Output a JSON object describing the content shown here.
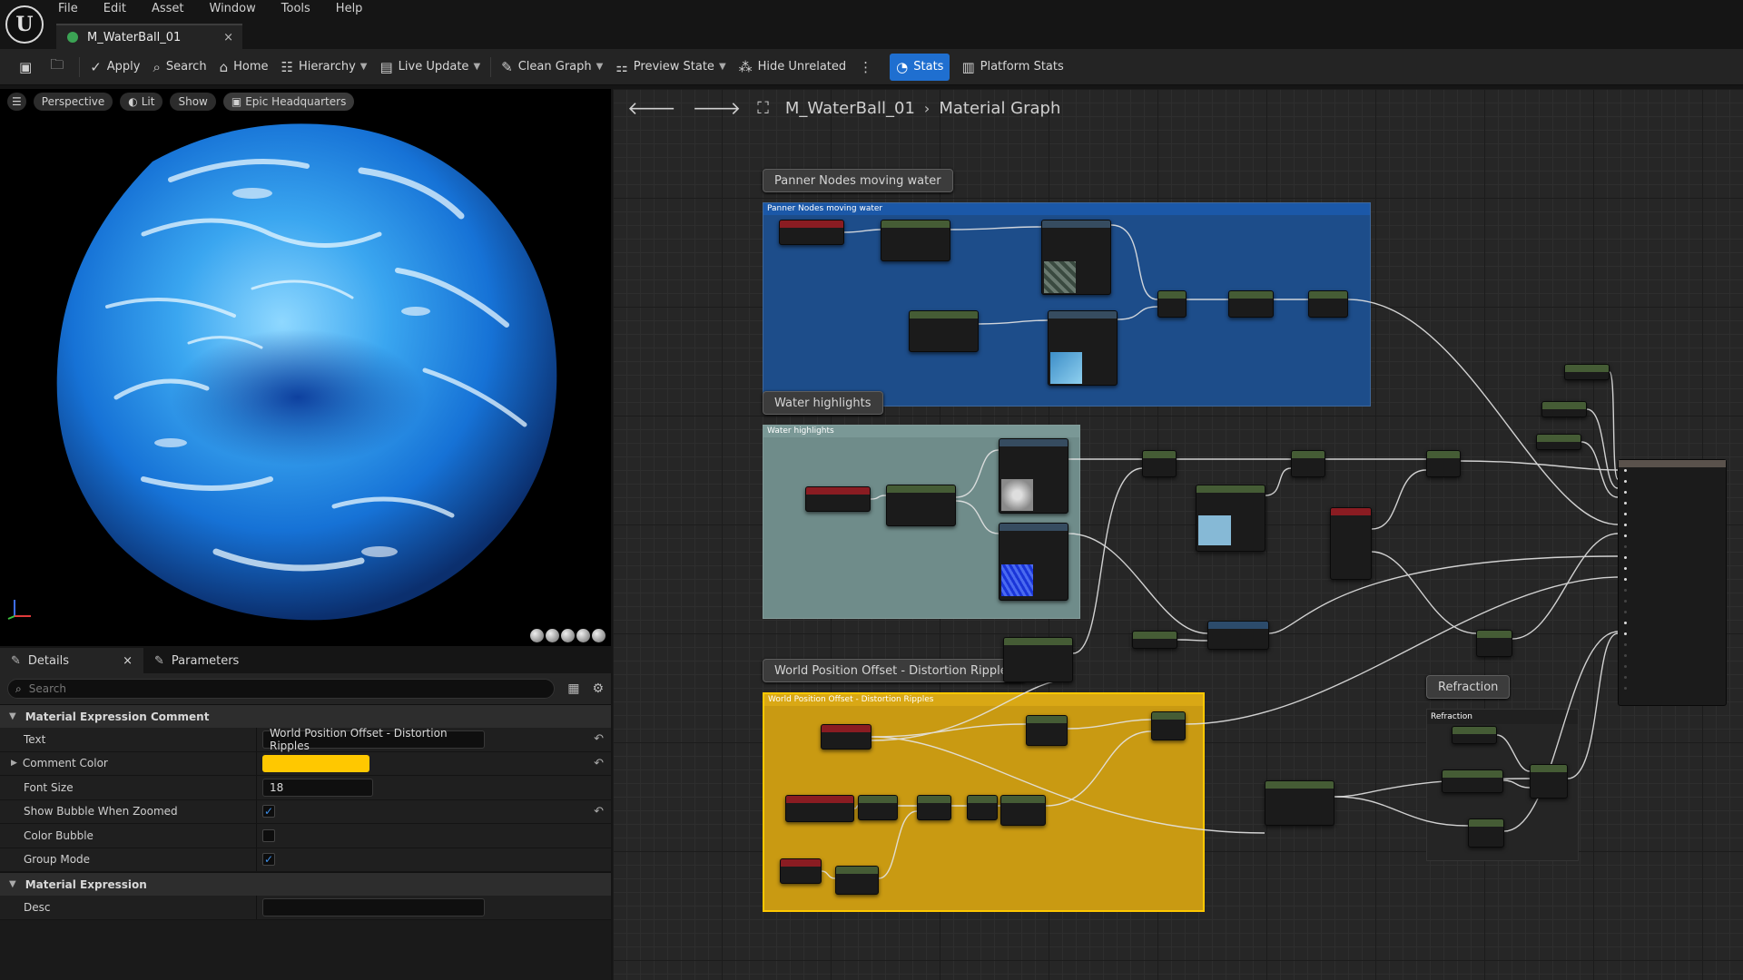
{
  "menu": [
    "File",
    "Edit",
    "Asset",
    "Window",
    "Tools",
    "Help"
  ],
  "tab": {
    "label": "M_WaterBall_01",
    "close": "×"
  },
  "toolbar": {
    "apply": "Apply",
    "search": "Search",
    "home": "Home",
    "hierarchy": "Hierarchy",
    "live_update": "Live Update",
    "clean_graph": "Clean Graph",
    "preview_state": "Preview State",
    "hide_unrelated": "Hide Unrelated",
    "stats": "Stats",
    "platform_stats": "Platform Stats"
  },
  "viewport": {
    "perspective": "Perspective",
    "lit": "Lit",
    "show": "Show",
    "environment": "Epic Headquarters"
  },
  "details": {
    "tab_details": "Details",
    "tab_close": "×",
    "tab_parameters": "Parameters",
    "search_placeholder": "Search",
    "cat_comment": "Material Expression Comment",
    "text_label": "Text",
    "text_value": "World Position Offset - Distortion Ripples",
    "comment_color_label": "Comment Color",
    "comment_color": "#ffc800",
    "font_size_label": "Font Size",
    "font_size": "18",
    "show_bubble_label": "Show Bubble When Zoomed",
    "show_bubble": true,
    "color_bubble_label": "Color Bubble",
    "color_bubble": false,
    "group_mode_label": "Group Mode",
    "group_mode": true,
    "cat_expression": "Material Expression",
    "desc_label": "Desc",
    "desc_value": ""
  },
  "graph": {
    "crumb_asset": "M_WaterBall_01",
    "crumb_graph": "Material Graph",
    "comments": {
      "panner": "Panner Nodes moving water",
      "highlights": "Water highlights",
      "wpo": "World Position Offset - Distortion Ripples",
      "refraction": "Refraction"
    },
    "colors": {
      "panner": "#1d4d8a",
      "highlights": "#6f8c8a",
      "wpo": "#c99a12"
    }
  }
}
